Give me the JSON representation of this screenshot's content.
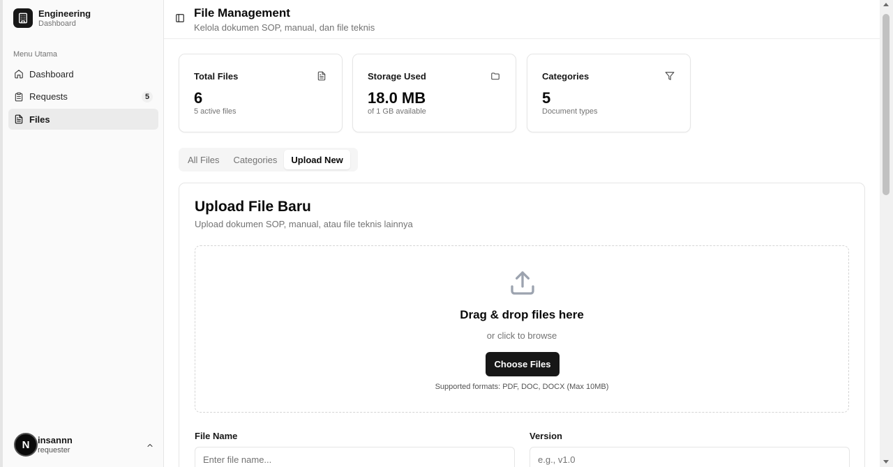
{
  "brand": {
    "title": "Engineering",
    "subtitle": "Dashboard",
    "icon": "building-icon"
  },
  "sidebar": {
    "group_label": "Menu Utama",
    "items": [
      {
        "label": "Dashboard",
        "icon": "home-icon",
        "active": false
      },
      {
        "label": "Requests",
        "icon": "clipboard-icon",
        "badge": "5",
        "active": false
      },
      {
        "label": "Files",
        "icon": "file-icon",
        "active": true
      }
    ],
    "user": {
      "initial": "N",
      "name": "insannn",
      "role": "requester"
    }
  },
  "header": {
    "title": "File Management",
    "subtitle": "Kelola dokumen SOP, manual, dan file teknis"
  },
  "stats": [
    {
      "label": "Total Files",
      "value": "6",
      "desc": "5 active files",
      "icon": "file-icon"
    },
    {
      "label": "Storage Used",
      "value": "18.0 MB",
      "desc": "of 1 GB available",
      "icon": "folder-icon"
    },
    {
      "label": "Categories",
      "value": "5",
      "desc": "Document types",
      "icon": "filter-icon"
    }
  ],
  "tabs": [
    {
      "label": "All Files",
      "active": false
    },
    {
      "label": "Categories",
      "active": false
    },
    {
      "label": "Upload New",
      "active": true
    }
  ],
  "upload": {
    "title": "Upload File Baru",
    "subtitle": "Upload dokumen SOP, manual, atau file teknis lainnya",
    "drop_title": "Drag & drop files here",
    "drop_sub": "or click to browse",
    "button": "Choose Files",
    "formats": "Supported formats: PDF, DOC, DOCX (Max 10MB)",
    "file_name_label": "File Name",
    "file_name_placeholder": "Enter file name...",
    "version_label": "Version",
    "version_placeholder": "e.g., v1.0"
  },
  "colors": {
    "accent": "#171717",
    "muted": "#737373",
    "border": "#e5e5e5"
  }
}
